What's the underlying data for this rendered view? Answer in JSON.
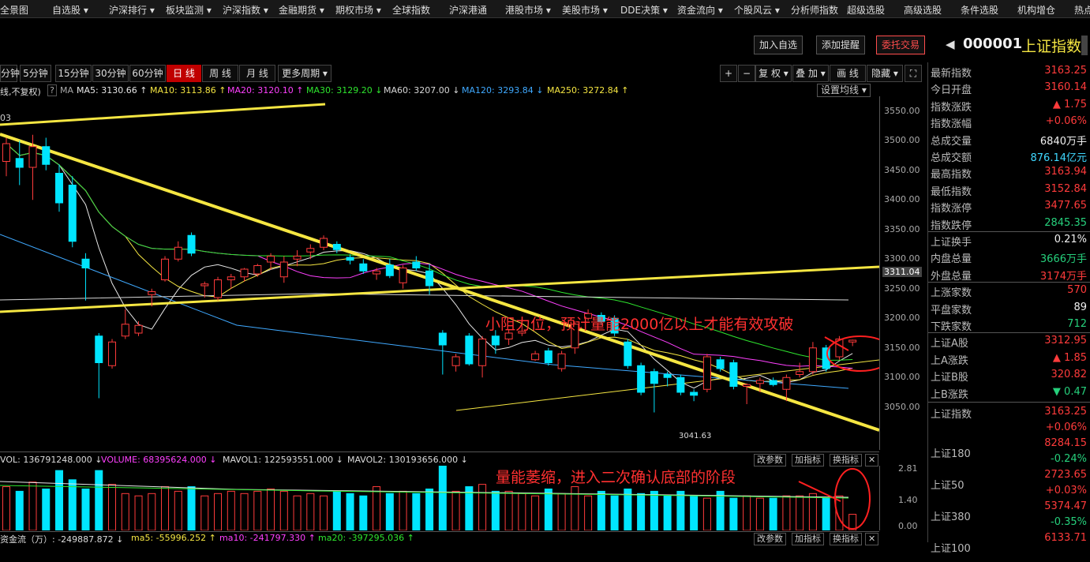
{
  "top_menu": [
    "全景图",
    "自选股 ▾",
    "沪深排行 ▾",
    "板块监测 ▾",
    "沪深指数 ▾",
    "金融期货 ▾",
    "期权市场 ▾",
    "全球指数",
    "沪深港通",
    "港股市场 ▾",
    "美股市场 ▾",
    "DDE决策 ▾",
    "资金流向 ▾",
    "个股风云 ▾",
    "分析师指数",
    "超级选股",
    "高级选股",
    "条件选股",
    "机构增仓",
    "热点"
  ],
  "actions": {
    "add_watch": "加入自选",
    "add_alert": "添加提醒",
    "entrust": "委托交易"
  },
  "symbol": {
    "code": "000001",
    "name": "上证指数"
  },
  "periods": [
    "分钟",
    "5分钟",
    "15分钟",
    "30分钟",
    "60分钟",
    "日 线",
    "周 线",
    "月 线",
    "更多周期 ▾"
  ],
  "toolbar": {
    "plus": "+",
    "minus": "−",
    "fq": "复 权 ▾",
    "overlay": "叠 加 ▾",
    "draw": "画 线",
    "hide": "隐藏 ▾",
    "expand": "⛶"
  },
  "ma_bar": {
    "prefix": "线,不复权)",
    "help": "?",
    "ma_label": "MA",
    "settings": "设置均线 ▾",
    "items": [
      {
        "text": "MA5: 3130.66 ↑",
        "color": "#e8e8e8"
      },
      {
        "text": "MA10: 3113.86 ↑",
        "color": "#f5e642"
      },
      {
        "text": "MA20: 3120.10 ↑",
        "color": "#ff40ff"
      },
      {
        "text": "MA30: 3129.20 ↓",
        "color": "#2ee62e"
      },
      {
        "text": "MA60: 3207.00 ↓",
        "color": "#d8d8d8"
      },
      {
        "text": "MA120: 3293.84 ↓",
        "color": "#3fa9ff"
      },
      {
        "text": "MA250: 3272.84 ↑",
        "color": "#f5e642"
      }
    ]
  },
  "corner_label": "03",
  "price_axis": [
    "3550.00",
    "3500.00",
    "3450.00",
    "3400.00",
    "3350.00",
    "3300.00",
    "3250.00",
    "3200.00",
    "3150.00",
    "3100.00",
    "3050.00"
  ],
  "current_price_tag": "3311.04",
  "low_marker": "3041.63",
  "annotation1": "小阻力位，预计量能2000亿以上才能有效攻破",
  "annotation2": "量能萎缩，进入二次确认底部的阶段",
  "volume_bar": {
    "vol": "VOL: 136791248.000 ↓",
    "volume": "VOLUME: 68395624.000 ↓",
    "mavol1": "MAVOL1: 122593551.000 ↓",
    "mavol2": "MAVOL2: 130193656.000 ↓",
    "btn1": "改参数",
    "btn2": "加指标",
    "btn3": "换指标",
    "close": "✕"
  },
  "vol_axis": [
    "2.81",
    "1.40",
    "0.00"
  ],
  "flow_bar": {
    "label": "资金流（万）: -249887.872 ↓",
    "ma5": "ma5: -55996.252 ↑",
    "ma10": "ma10: -241797.330 ↑",
    "ma20": "ma20: -397295.036 ↑"
  },
  "right_panel": [
    {
      "label": "最新指数",
      "value": "3163.25",
      "color": "red"
    },
    {
      "label": "今日开盘",
      "value": "3160.14",
      "color": "red"
    },
    {
      "label": "指数涨跌",
      "value": "▲ 1.75",
      "color": "red"
    },
    {
      "label": "指数涨幅",
      "value": "+0.06%",
      "color": "red"
    },
    {
      "label": "总成交量",
      "value": "6840万手",
      "color": "white"
    },
    {
      "label": "总成交额",
      "value": "876.14亿元",
      "color": "cyan"
    },
    {
      "label": "最高指数",
      "value": "3163.94",
      "color": "red"
    },
    {
      "label": "最低指数",
      "value": "3152.84",
      "color": "red"
    },
    {
      "label": "指数涨停",
      "value": "3477.65",
      "color": "red"
    },
    {
      "label": "指数跌停",
      "value": "2845.35",
      "color": "green"
    },
    {
      "label": "上证换手",
      "value": "0.21%",
      "color": "white"
    },
    {
      "label": "内盘总量",
      "value": "3666万手",
      "color": "green"
    },
    {
      "label": "外盘总量",
      "value": "3174万手",
      "color": "red"
    },
    {
      "label": "上涨家数",
      "value": "570",
      "color": "red"
    },
    {
      "label": "平盘家数",
      "value": "89",
      "color": "white"
    },
    {
      "label": "下跌家数",
      "value": "712",
      "color": "green"
    },
    {
      "label": "上证A股",
      "value": "3312.95",
      "color": "red"
    },
    {
      "label": "上A涨跌",
      "value": "▲ 1.85",
      "color": "red"
    },
    {
      "label": "上证B股",
      "value": "320.82",
      "color": "red"
    },
    {
      "label": "上B涨跌",
      "value": "▼ 0.47",
      "color": "green"
    }
  ],
  "right_indices": [
    {
      "label": "上证指数",
      "value": "3163.25",
      "chg": "+0.06%",
      "chgcolor": "red"
    },
    {
      "label": "上证180",
      "value": "8284.15",
      "chg": "-0.24%",
      "chgcolor": "green"
    },
    {
      "label": "上证50",
      "value": "2723.65",
      "chg": "+0.03%",
      "chgcolor": "red"
    },
    {
      "label": "上证380",
      "value": "5374.47",
      "chg": "-0.35%",
      "chgcolor": "green"
    },
    {
      "label": "上证100",
      "value": "6133.71",
      "chg": "",
      "chgcolor": "red"
    }
  ],
  "candles": [
    {
      "o": 3465,
      "h": 3505,
      "l": 3440,
      "c": 3495
    },
    {
      "o": 3470,
      "h": 3500,
      "l": 3425,
      "c": 3455
    },
    {
      "o": 3455,
      "h": 3510,
      "l": 3400,
      "c": 3490
    },
    {
      "o": 3490,
      "h": 3505,
      "l": 3450,
      "c": 3460
    },
    {
      "o": 3445,
      "h": 3460,
      "l": 3380,
      "c": 3395
    },
    {
      "o": 3425,
      "h": 3440,
      "l": 3320,
      "c": 3330
    },
    {
      "o": 3300,
      "h": 3310,
      "l": 3230,
      "c": 3285
    },
    {
      "o": 3170,
      "h": 3175,
      "l": 3065,
      "c": 3125
    },
    {
      "o": 3120,
      "h": 3165,
      "l": 3115,
      "c": 3160
    },
    {
      "o": 3170,
      "h": 3215,
      "l": 3165,
      "c": 3190
    },
    {
      "o": 3175,
      "h": 3195,
      "l": 3170,
      "c": 3188
    },
    {
      "o": 3240,
      "h": 3250,
      "l": 3220,
      "c": 3245
    },
    {
      "o": 3265,
      "h": 3305,
      "l": 3262,
      "c": 3300
    },
    {
      "o": 3300,
      "h": 3330,
      "l": 3296,
      "c": 3320
    },
    {
      "o": 3340,
      "h": 3345,
      "l": 3305,
      "c": 3310
    },
    {
      "o": 3255,
      "h": 3262,
      "l": 3235,
      "c": 3258
    },
    {
      "o": 3235,
      "h": 3270,
      "l": 3230,
      "c": 3265
    },
    {
      "o": 3265,
      "h": 3275,
      "l": 3250,
      "c": 3270
    },
    {
      "o": 3270,
      "h": 3285,
      "l": 3262,
      "c": 3283
    },
    {
      "o": 3275,
      "h": 3292,
      "l": 3270,
      "c": 3289
    },
    {
      "o": 3295,
      "h": 3310,
      "l": 3282,
      "c": 3305
    },
    {
      "o": 3270,
      "h": 3305,
      "l": 3260,
      "c": 3295
    },
    {
      "o": 3300,
      "h": 3315,
      "l": 3288,
      "c": 3305
    },
    {
      "o": 3312,
      "h": 3325,
      "l": 3300,
      "c": 3318
    },
    {
      "o": 3320,
      "h": 3340,
      "l": 3315,
      "c": 3335
    },
    {
      "o": 3325,
      "h": 3330,
      "l": 3310,
      "c": 3316
    },
    {
      "o": 3303,
      "h": 3308,
      "l": 3291,
      "c": 3298
    },
    {
      "o": 3292,
      "h": 3300,
      "l": 3275,
      "c": 3280
    },
    {
      "o": 3275,
      "h": 3285,
      "l": 3265,
      "c": 3280
    },
    {
      "o": 3290,
      "h": 3300,
      "l": 3268,
      "c": 3272
    },
    {
      "o": 3260,
      "h": 3290,
      "l": 3250,
      "c": 3285
    },
    {
      "o": 3295,
      "h": 3305,
      "l": 3280,
      "c": 3285
    },
    {
      "o": 3280,
      "h": 3292,
      "l": 3240,
      "c": 3255
    },
    {
      "o": 3175,
      "h": 3180,
      "l": 3105,
      "c": 3155
    },
    {
      "o": 3120,
      "h": 3140,
      "l": 3110,
      "c": 3135
    },
    {
      "o": 3170,
      "h": 3175,
      "l": 3120,
      "c": 3123
    },
    {
      "o": 3120,
      "h": 3170,
      "l": 3100,
      "c": 3165
    },
    {
      "o": 3170,
      "h": 3180,
      "l": 3140,
      "c": 3155
    },
    {
      "o": 3165,
      "h": 3180,
      "l": 3155,
      "c": 3175
    },
    {
      "o": 3175,
      "h": 3195,
      "l": 3170,
      "c": 3178
    },
    {
      "o": 3130,
      "h": 3145,
      "l": 3128,
      "c": 3140
    },
    {
      "o": 3145,
      "h": 3150,
      "l": 3120,
      "c": 3125
    },
    {
      "o": 3115,
      "h": 3145,
      "l": 3110,
      "c": 3140
    },
    {
      "o": 3150,
      "h": 3195,
      "l": 3140,
      "c": 3190
    },
    {
      "o": 3200,
      "h": 3215,
      "l": 3196,
      "c": 3208
    },
    {
      "o": 3205,
      "h": 3210,
      "l": 3190,
      "c": 3195
    },
    {
      "o": 3200,
      "h": 3205,
      "l": 3170,
      "c": 3175
    },
    {
      "o": 3160,
      "h": 3165,
      "l": 3115,
      "c": 3120
    },
    {
      "o": 3120,
      "h": 3125,
      "l": 3070,
      "c": 3075
    },
    {
      "o": 3110,
      "h": 3115,
      "l": 3041,
      "c": 3090
    },
    {
      "o": 3105,
      "h": 3110,
      "l": 3085,
      "c": 3100
    },
    {
      "o": 3100,
      "h": 3105,
      "l": 3070,
      "c": 3075
    },
    {
      "o": 3075,
      "h": 3080,
      "l": 3060,
      "c": 3070
    },
    {
      "o": 3080,
      "h": 3140,
      "l": 3075,
      "c": 3135
    },
    {
      "o": 3130,
      "h": 3135,
      "l": 3110,
      "c": 3115
    },
    {
      "o": 3125,
      "h": 3130,
      "l": 3080,
      "c": 3085
    },
    {
      "o": 3085,
      "h": 3090,
      "l": 3055,
      "c": 3088
    },
    {
      "o": 3090,
      "h": 3100,
      "l": 3075,
      "c": 3095
    },
    {
      "o": 3095,
      "h": 3100,
      "l": 3085,
      "c": 3088
    },
    {
      "o": 3080,
      "h": 3105,
      "l": 3060,
      "c": 3100
    },
    {
      "o": 3105,
      "h": 3125,
      "l": 3100,
      "c": 3110
    },
    {
      "o": 3110,
      "h": 3160,
      "l": 3105,
      "c": 3150
    },
    {
      "o": 3150,
      "h": 3155,
      "l": 3110,
      "c": 3115
    },
    {
      "o": 3135,
      "h": 3170,
      "l": 3130,
      "c": 3165
    },
    {
      "o": 3160,
      "h": 3164,
      "l": 3153,
      "c": 3163
    }
  ],
  "volumes": [
    1.9,
    1.7,
    2.1,
    1.8,
    2.6,
    2.2,
    1.8,
    2.6,
    2.0,
    1.6,
    1.5,
    1.6,
    1.9,
    1.7,
    1.9,
    1.5,
    1.6,
    1.7,
    1.6,
    1.7,
    1.8,
    1.7,
    1.5,
    1.6,
    1.5,
    1.7,
    1.6,
    1.5,
    1.9,
    1.6,
    1.7,
    1.6,
    1.8,
    2.8,
    1.7,
    1.9,
    2.0,
    1.7,
    1.7,
    1.6,
    1.5,
    1.8,
    1.6,
    1.9,
    1.5,
    1.7,
    1.5,
    1.8,
    1.6,
    1.7,
    1.5,
    1.7,
    1.5,
    1.4,
    1.7,
    1.4,
    1.5,
    1.4,
    1.4,
    1.5,
    1.5,
    1.6,
    1.4,
    1.5,
    0.7
  ]
}
